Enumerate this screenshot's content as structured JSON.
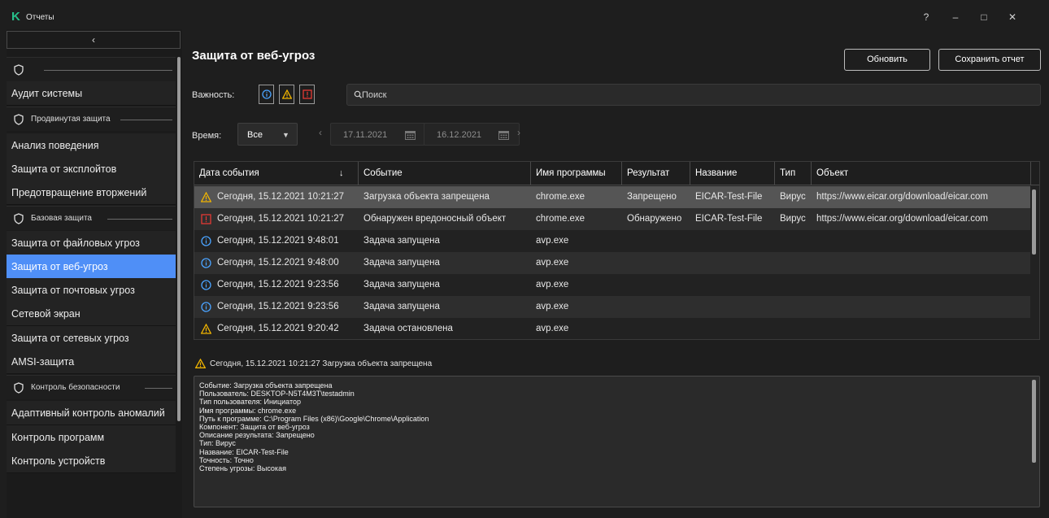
{
  "window": {
    "title": "Отчеты",
    "logo_text": "K",
    "help": "?",
    "minimize": "–",
    "maximize": "□",
    "close": "✕"
  },
  "sidebar": {
    "collapse_icon": "chevron-left",
    "items": [
      {
        "type": "group",
        "label": "",
        "icon": "shield-icon"
      },
      {
        "type": "item",
        "label": "Аудит системы"
      },
      {
        "type": "group",
        "label": "Продвинутая защита",
        "icon": "advanced-shield-icon"
      },
      {
        "type": "item",
        "label": "Анализ поведения"
      },
      {
        "type": "item",
        "label": "Защита от эксплойтов"
      },
      {
        "type": "item",
        "label": "Предотвращение вторжений"
      },
      {
        "type": "group",
        "label": "Базовая защита",
        "icon": "shield-icon"
      },
      {
        "type": "item",
        "label": "Защита от файловых угроз"
      },
      {
        "type": "item",
        "label": "Защита от веб-угроз",
        "active": true
      },
      {
        "type": "item",
        "label": "Защита от почтовых угроз"
      },
      {
        "type": "item",
        "label": "Сетевой экран"
      },
      {
        "type": "item",
        "label": "Защита от сетевых угроз"
      },
      {
        "type": "item",
        "label": "AMSI-защита"
      },
      {
        "type": "group",
        "label": "Контроль безопасности",
        "icon": "security-control-icon"
      },
      {
        "type": "item",
        "label": "Адаптивный контроль аномалий"
      },
      {
        "type": "item",
        "label": "Контроль программ"
      },
      {
        "type": "item",
        "label": "Контроль устройств"
      }
    ]
  },
  "main": {
    "title": "Защита от веб-угроз",
    "refresh_label": "Обновить",
    "save_report_label": "Сохранить отчет",
    "severity_label": "Важность:",
    "search_placeholder": "Поиск",
    "time_label": "Время:",
    "time_value": "Все",
    "date_from": "17.11.2021",
    "date_to": "16.12.2021"
  },
  "table": {
    "columns": [
      "Дата события",
      "Событие",
      "Имя программы",
      "Результат",
      "Название",
      "Тип",
      "Объект"
    ],
    "rows": [
      {
        "severity": "warning",
        "date": "Сегодня, 15.12.2021 10:21:27",
        "event": "Загрузка объекта запрещена",
        "program": "chrome.exe",
        "result": "Запрещено",
        "name": "EICAR-Test-File",
        "type": "Вирус",
        "object": "https://www.eicar.org/download/eicar.com",
        "selected": true
      },
      {
        "severity": "critical",
        "date": "Сегодня, 15.12.2021 10:21:27",
        "event": "Обнаружен вредоносный объект",
        "program": "chrome.exe",
        "result": "Обнаружено",
        "name": "EICAR-Test-File",
        "type": "Вирус",
        "object": "https://www.eicar.org/download/eicar.com"
      },
      {
        "severity": "info",
        "date": "Сегодня, 15.12.2021 9:48:01",
        "event": "Задача запущена",
        "program": "avp.exe",
        "result": "",
        "name": "",
        "type": "",
        "object": ""
      },
      {
        "severity": "info",
        "date": "Сегодня, 15.12.2021 9:48:00",
        "event": "Задача запущена",
        "program": "avp.exe",
        "result": "",
        "name": "",
        "type": "",
        "object": ""
      },
      {
        "severity": "info",
        "date": "Сегодня, 15.12.2021 9:23:56",
        "event": "Задача запущена",
        "program": "avp.exe",
        "result": "",
        "name": "",
        "type": "",
        "object": ""
      },
      {
        "severity": "info",
        "date": "Сегодня, 15.12.2021 9:23:56",
        "event": "Задача запущена",
        "program": "avp.exe",
        "result": "",
        "name": "",
        "type": "",
        "object": ""
      },
      {
        "severity": "warning",
        "date": "Сегодня, 15.12.2021 9:20:42",
        "event": "Задача остановлена",
        "program": "avp.exe",
        "result": "",
        "name": "",
        "type": "",
        "object": ""
      }
    ]
  },
  "details": {
    "title": "Сегодня, 15.12.2021 10:21:27 Загрузка объекта запрещена",
    "lines": [
      "Событие: Загрузка объекта запрещена",
      "Пользователь: DESKTOP-N5T4M3T\\testadmin",
      "Тип пользователя: Инициатор",
      "Имя программы: chrome.exe",
      "Путь к программе: C:\\Program Files (x86)\\Google\\Chrome\\Application",
      "Компонент: Защита от веб-угроз",
      "Описание результата: Запрещено",
      "Тип: Вирус",
      "Название: EICAR-Test-File",
      "Точность: Точно",
      "Степень угрозы: Высокая"
    ]
  },
  "colors": {
    "accent": "#4f8ff7",
    "info": "#4aa3ff",
    "warning": "#f0b400",
    "critical": "#e53935",
    "brand": "#27c08a"
  }
}
